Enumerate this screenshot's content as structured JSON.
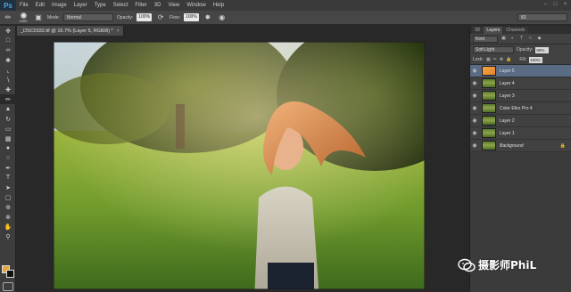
{
  "app": {
    "logo": "Ps"
  },
  "menu": [
    "File",
    "Edit",
    "Image",
    "Layer",
    "Type",
    "Select",
    "Filter",
    "3D",
    "View",
    "Window",
    "Help"
  ],
  "window_buttons": [
    "–",
    "□",
    "×"
  ],
  "options": {
    "brush_size": "1000",
    "mode_label": "Mode:",
    "mode_value": "Normal",
    "opacity_label": "Opacity:",
    "opacity_value": "100%",
    "flow_label": "Flow:",
    "flow_value": "100%",
    "workspace": "83"
  },
  "document": {
    "tab_title": "_DSC0332.tif @ 16.7% (Layer 5, RGB/8) *",
    "close_glyph": "×"
  },
  "panel": {
    "tabs": [
      "3D",
      "Layers",
      "Channels"
    ],
    "active_tab": "Layers",
    "kind": "Kind",
    "blend_mode": "Soft Light",
    "opacity_label": "Opacity:",
    "opacity_value": "80%",
    "lock_label": "Lock:",
    "fill_label": "Fill:",
    "fill_value": "100%",
    "layers": [
      {
        "name": "Layer 5",
        "thumb": "orange",
        "selected": true
      },
      {
        "name": "Layer 4",
        "thumb": "photo",
        "selected": false
      },
      {
        "name": "Layer 3",
        "thumb": "photo",
        "selected": false
      },
      {
        "name": "Color Efex Pro 4",
        "thumb": "photo",
        "selected": false
      },
      {
        "name": "Layer 2",
        "thumb": "photo",
        "selected": false
      },
      {
        "name": "Layer 1",
        "thumb": "photo",
        "selected": false
      },
      {
        "name": "Background",
        "thumb": "photo",
        "selected": false,
        "locked": true
      }
    ]
  },
  "colors": {
    "foreground": "#e7a63c",
    "background": "#111111",
    "selected_layer": "#5a6b84"
  },
  "watermark": {
    "text": "摄影师PhiL"
  }
}
